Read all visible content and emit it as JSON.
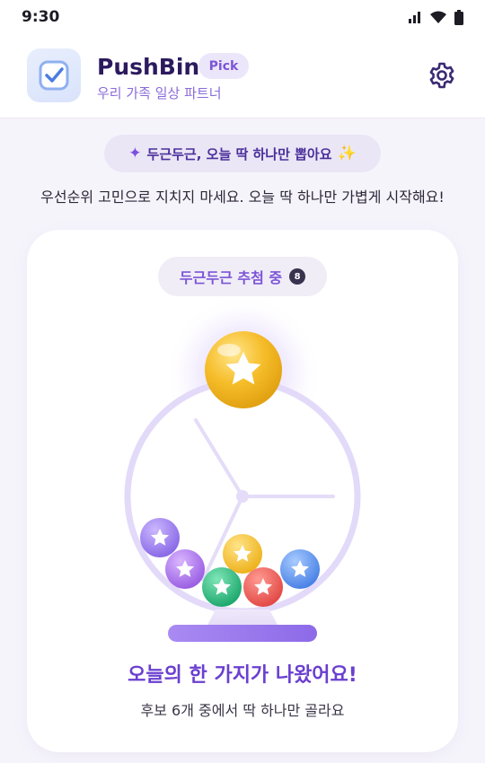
{
  "status_bar": {
    "time": "9:30",
    "icons": [
      "signal-icon",
      "wifi-icon",
      "battery-icon"
    ]
  },
  "app_bar": {
    "title": "PushBin",
    "badge": "Pick",
    "subtitle": "우리 가족 일상 파트너",
    "logo_icon": "checkbox-icon",
    "settings_icon": "gear-icon"
  },
  "banner": {
    "text": "두근두근, 오늘 딱 하나만 뽑아요",
    "left_icon": "sparkle-icon",
    "right_icon": "sparkles-icon"
  },
  "tagline": "우선순위 고민으로 지치지 마세요. 오늘 딱 하나만 가볍게 시작해요!",
  "machine": {
    "status_label": "두근두근 추첨 중",
    "status_count": "8",
    "selected_ball_color": "#f5b824",
    "balls": [
      {
        "color": "purple",
        "hex": "#a48af0"
      },
      {
        "color": "violet",
        "hex": "#b07cec"
      },
      {
        "color": "yellow",
        "hex": "#f6c435"
      },
      {
        "color": "green",
        "hex": "#2fbf84"
      },
      {
        "color": "red",
        "hex": "#f0655f"
      },
      {
        "color": "blue",
        "hex": "#6aa0f0"
      }
    ],
    "result_title": "오늘의 한 가지가 나왔어요!",
    "result_subtitle": "후보 6개 중에서 딱 하나만 골라요"
  },
  "colors": {
    "brand": "#2c1a5e",
    "accent": "#7c55d6",
    "background": "#f6f4fb"
  }
}
